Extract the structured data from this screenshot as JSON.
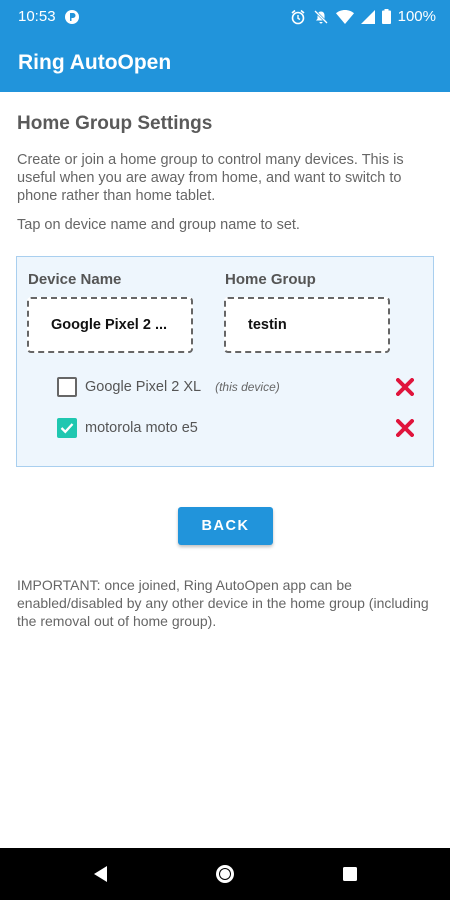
{
  "status_bar": {
    "time": "10:53",
    "battery": "100%",
    "icons": [
      "alarm-icon",
      "mute-icon",
      "wifi-icon",
      "signal-icon",
      "battery-icon"
    ]
  },
  "app_bar": {
    "title": "Ring AutoOpen"
  },
  "page": {
    "title": "Home Group Settings",
    "description": "Create or join a home group to control many devices. This is useful when you are away from home, and want to switch to phone rather than home tablet.",
    "hint": "Tap on device name and group name to set."
  },
  "group": {
    "device_name_label": "Device Name",
    "home_group_label": "Home Group",
    "device_name_value": "Google Pixel 2 ...",
    "home_group_value": "testin",
    "members": [
      {
        "name": "Google Pixel 2 XL",
        "note": "(this device)",
        "checked": false
      },
      {
        "name": "motorola moto e5",
        "note": "",
        "checked": true
      }
    ]
  },
  "back_button": {
    "label": "BACK"
  },
  "important": "IMPORTANT: once joined, Ring AutoOpen app can be enabled/disabled by any other device in the home group (including the removal out of home group).",
  "colors": {
    "primary": "#2194db",
    "checkbox_checked": "#1fc7b0",
    "remove": "#e0143c",
    "panel_bg": "#eef6fd"
  }
}
